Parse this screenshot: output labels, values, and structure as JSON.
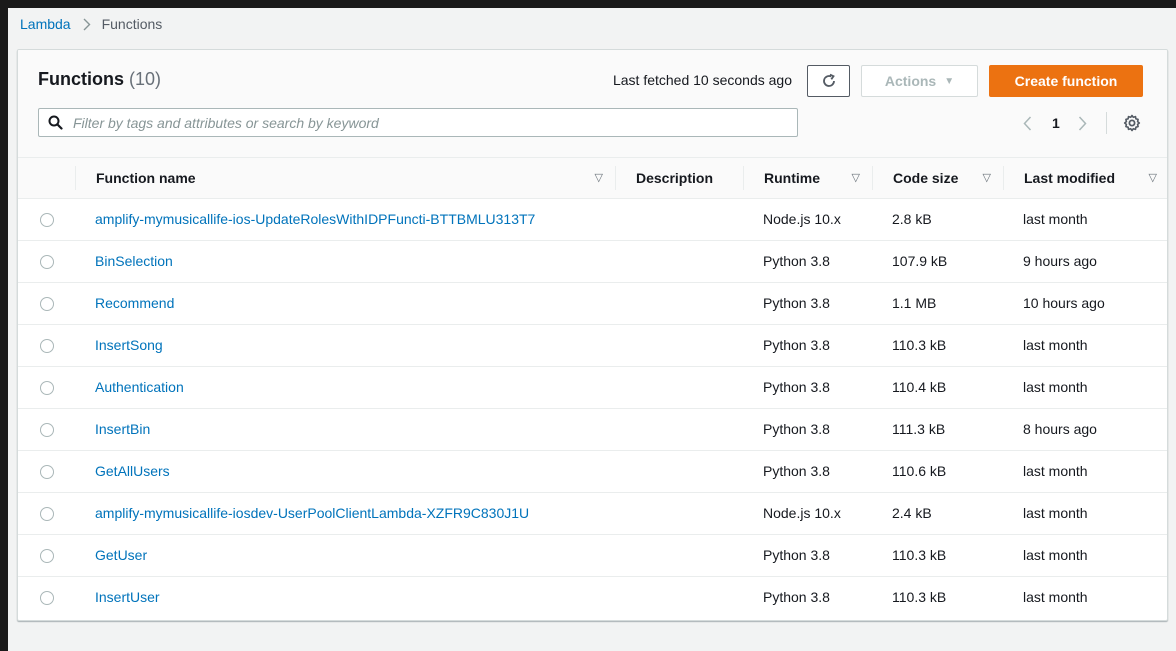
{
  "breadcrumb": {
    "parent": "Lambda",
    "current": "Functions"
  },
  "header": {
    "title": "Functions",
    "count": "(10)",
    "last_fetched": "Last fetched 10 seconds ago",
    "actions_label": "Actions",
    "create_label": "Create function"
  },
  "search": {
    "placeholder": "Filter by tags and attributes or search by keyword",
    "value": ""
  },
  "pagination": {
    "current_page": "1"
  },
  "columns": {
    "name": "Function name",
    "description": "Description",
    "runtime": "Runtime",
    "code_size": "Code size",
    "last_modified": "Last modified"
  },
  "functions": [
    {
      "name": "amplify-mymusicallife-ios-UpdateRolesWithIDPFuncti-BTTBMLU313T7",
      "description": "",
      "runtime": "Node.js 10.x",
      "code_size": "2.8 kB",
      "last_modified": "last month"
    },
    {
      "name": "BinSelection",
      "description": "",
      "runtime": "Python 3.8",
      "code_size": "107.9 kB",
      "last_modified": "9 hours ago"
    },
    {
      "name": "Recommend",
      "description": "",
      "runtime": "Python 3.8",
      "code_size": "1.1 MB",
      "last_modified": "10 hours ago"
    },
    {
      "name": "InsertSong",
      "description": "",
      "runtime": "Python 3.8",
      "code_size": "110.3 kB",
      "last_modified": "last month"
    },
    {
      "name": "Authentication",
      "description": "",
      "runtime": "Python 3.8",
      "code_size": "110.4 kB",
      "last_modified": "last month"
    },
    {
      "name": "InsertBin",
      "description": "",
      "runtime": "Python 3.8",
      "code_size": "111.3 kB",
      "last_modified": "8 hours ago"
    },
    {
      "name": "GetAllUsers",
      "description": "",
      "runtime": "Python 3.8",
      "code_size": "110.6 kB",
      "last_modified": "last month"
    },
    {
      "name": "amplify-mymusicallife-iosdev-UserPoolClientLambda-XZFR9C830J1U",
      "description": "",
      "runtime": "Node.js 10.x",
      "code_size": "2.4 kB",
      "last_modified": "last month"
    },
    {
      "name": "GetUser",
      "description": "",
      "runtime": "Python 3.8",
      "code_size": "110.3 kB",
      "last_modified": "last month"
    },
    {
      "name": "InsertUser",
      "description": "",
      "runtime": "Python 3.8",
      "code_size": "110.3 kB",
      "last_modified": "last month"
    }
  ],
  "icons": {
    "breadcrumb_separator": "chevron-right-icon",
    "refresh": "refresh-icon",
    "actions_caret": "caret-down-icon",
    "search": "search-icon",
    "prev_page": "chevron-left-icon",
    "next_page": "chevron-right-icon",
    "settings": "gear-icon",
    "sort": "sort-caret-icon"
  },
  "colors": {
    "link": "#0073bb",
    "primary_button": "#ec7211",
    "text": "#16191f",
    "muted": "#687078",
    "border": "#eaeded"
  }
}
